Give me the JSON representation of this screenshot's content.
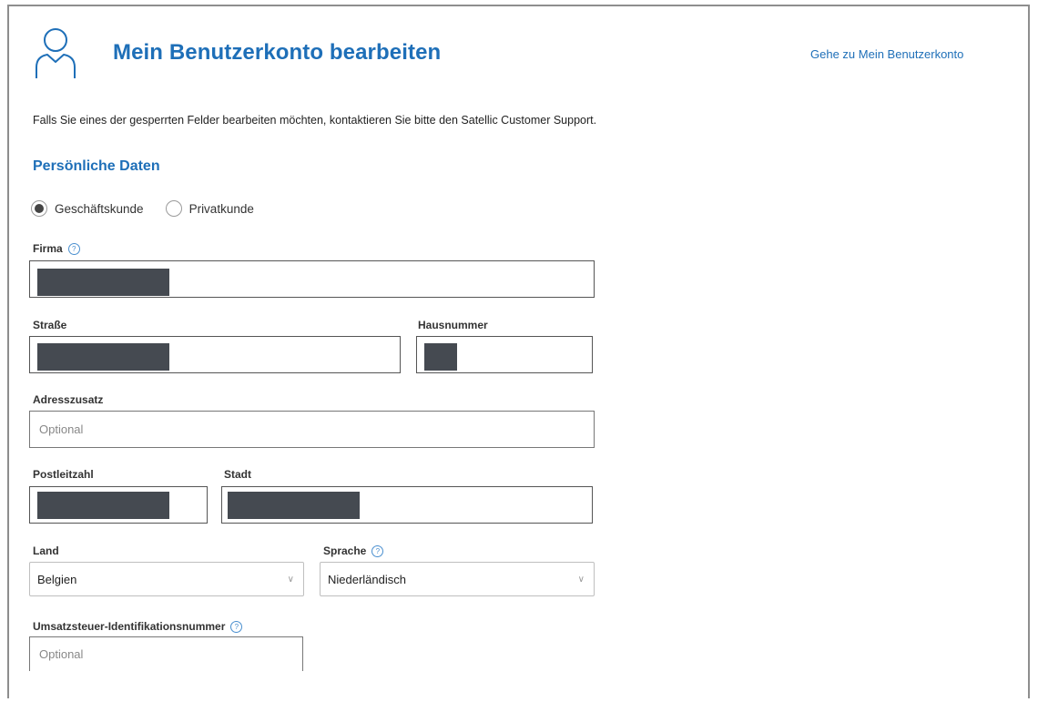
{
  "header": {
    "title": "Mein Benutzerkonto bearbeiten",
    "link": "Gehe zu Mein Benutzerkonto"
  },
  "info": "Falls Sie eines der gesperrten Felder bearbeiten möchten, kontaktieren Sie bitte den Satellic Customer Support.",
  "section": "Persönliche Daten",
  "customer_type": {
    "options": [
      "Geschäftskunde",
      "Privatkunde"
    ],
    "selected": "Geschäftskunde"
  },
  "fields": {
    "firma": {
      "label": "Firma"
    },
    "strasse": {
      "label": "Straße"
    },
    "hausnummer": {
      "label": "Hausnummer"
    },
    "adresszusatz": {
      "label": "Adresszusatz",
      "placeholder": "Optional"
    },
    "postleitzahl": {
      "label": "Postleitzahl"
    },
    "stadt": {
      "label": "Stadt"
    },
    "land": {
      "label": "Land",
      "value": "Belgien"
    },
    "sprache": {
      "label": "Sprache",
      "value": "Niederländisch"
    },
    "ust_id": {
      "label": "Umsatzsteuer-Identifikationsnummer",
      "placeholder": "Optional"
    }
  },
  "icons": {
    "help": "question-circle-icon",
    "user": "user-outline-icon",
    "select": "chevron-down-icon"
  },
  "colors": {
    "accent": "#1e6fb8",
    "redaction": "#454a51"
  }
}
